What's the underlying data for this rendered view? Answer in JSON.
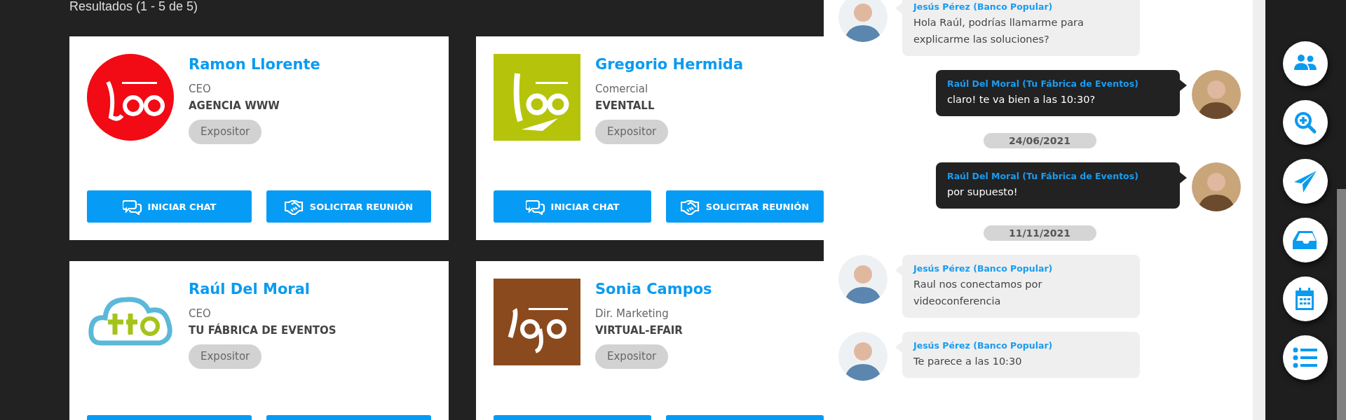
{
  "results_label": "Resultados (1 - 5 de 5)",
  "cards": [
    {
      "name": "Ramon Llorente",
      "role": "CEO",
      "company": "AGENCIA WWW",
      "badge": "Expositor",
      "buttons": [
        {
          "kind": "chat",
          "label": "INICIAR CHAT"
        },
        {
          "kind": "meeting",
          "label": "SOLICITAR REUNIÓN"
        }
      ]
    },
    {
      "name": "Gregorio Hermida",
      "role": "Comercial",
      "company": "EVENTALL",
      "badge": "Expositor",
      "buttons": [
        {
          "kind": "chat",
          "label": "INICIAR CHAT"
        },
        {
          "kind": "meeting",
          "label": "SOLICITAR REUNIÓN"
        }
      ]
    },
    {
      "name": "Raúl Del Moral",
      "role": "CEO",
      "company": "TU FÁBRICA DE EVENTOS",
      "badge": "Expositor",
      "buttons": [
        {
          "kind": "chat"
        },
        {
          "kind": "meeting"
        }
      ]
    },
    {
      "name": "Sonia Campos",
      "role": "Dir. Marketing",
      "company": "VIRTUAL-EFAIR",
      "badge": "Expositor",
      "buttons": [
        {
          "kind": "chat"
        },
        {
          "kind": "meeting"
        }
      ]
    }
  ],
  "chat": {
    "messages": [
      {
        "kind": "incoming",
        "sender": "Jesús Pérez (Banco Popular)",
        "text": "Hola Raúl, podrías llamarme para explicarme las soluciones?"
      },
      {
        "kind": "outgoing",
        "sender": "Raúl Del Moral (Tu Fábrica de Eventos)",
        "text": "claro! te va bien a las 10:30?"
      },
      {
        "kind": "date",
        "text": "24/06/2021"
      },
      {
        "kind": "outgoing",
        "sender": "Raúl Del Moral (Tu Fábrica de Eventos)",
        "text": "por supuesto!"
      },
      {
        "kind": "date",
        "text": "11/11/2021"
      },
      {
        "kind": "incoming",
        "sender": "Jesús Pérez (Banco Popular)",
        "text": "Raul nos conectamos por videoconferencia"
      },
      {
        "kind": "incoming",
        "sender": "Jesús Pérez (Banco Popular)",
        "text": "Te parece a las 10:30"
      }
    ]
  }
}
